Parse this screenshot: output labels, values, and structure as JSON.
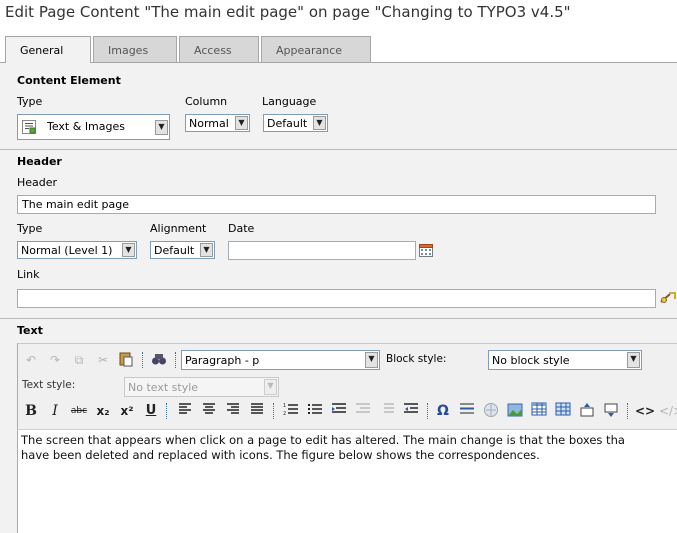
{
  "page_title": "Edit Page Content \"The main edit page\" on page \"Changing to TYPO3 v4.5\"",
  "tabs": [
    {
      "label": "General",
      "active": true
    },
    {
      "label": "Images",
      "active": false
    },
    {
      "label": "Access",
      "active": false
    },
    {
      "label": "Appearance",
      "active": false
    }
  ],
  "content_element": {
    "title": "Content Element",
    "type_label": "Type",
    "type_value": "Text & Images",
    "column_label": "Column",
    "column_value": "Normal",
    "language_label": "Language",
    "language_value": "Default"
  },
  "header": {
    "section_title": "Header",
    "header_label": "Header",
    "header_value": "The main edit page",
    "type_label": "Type",
    "type_value": "Normal (Level 1)",
    "alignment_label": "Alignment",
    "alignment_value": "Default",
    "date_label": "Date",
    "date_value": "",
    "link_label": "Link",
    "link_value": ""
  },
  "text": {
    "section_title": "Text",
    "paragraph_value": "Paragraph - p",
    "block_style_label": "Block style:",
    "block_style_value": "No block style",
    "text_style_label": "Text style:",
    "text_style_value": "No text style",
    "body_line1": "The screen that appears when click on a page to edit has altered. The main change is that the boxes tha",
    "body_line2": "have been deleted and replaced with icons. The figure below shows the correspondences."
  },
  "colors": {
    "tab_bg": "#d7d7d7",
    "panel_bg": "#f2f2f2",
    "border": "#a6a6a6",
    "separator_blue": "#3a6ea5"
  }
}
